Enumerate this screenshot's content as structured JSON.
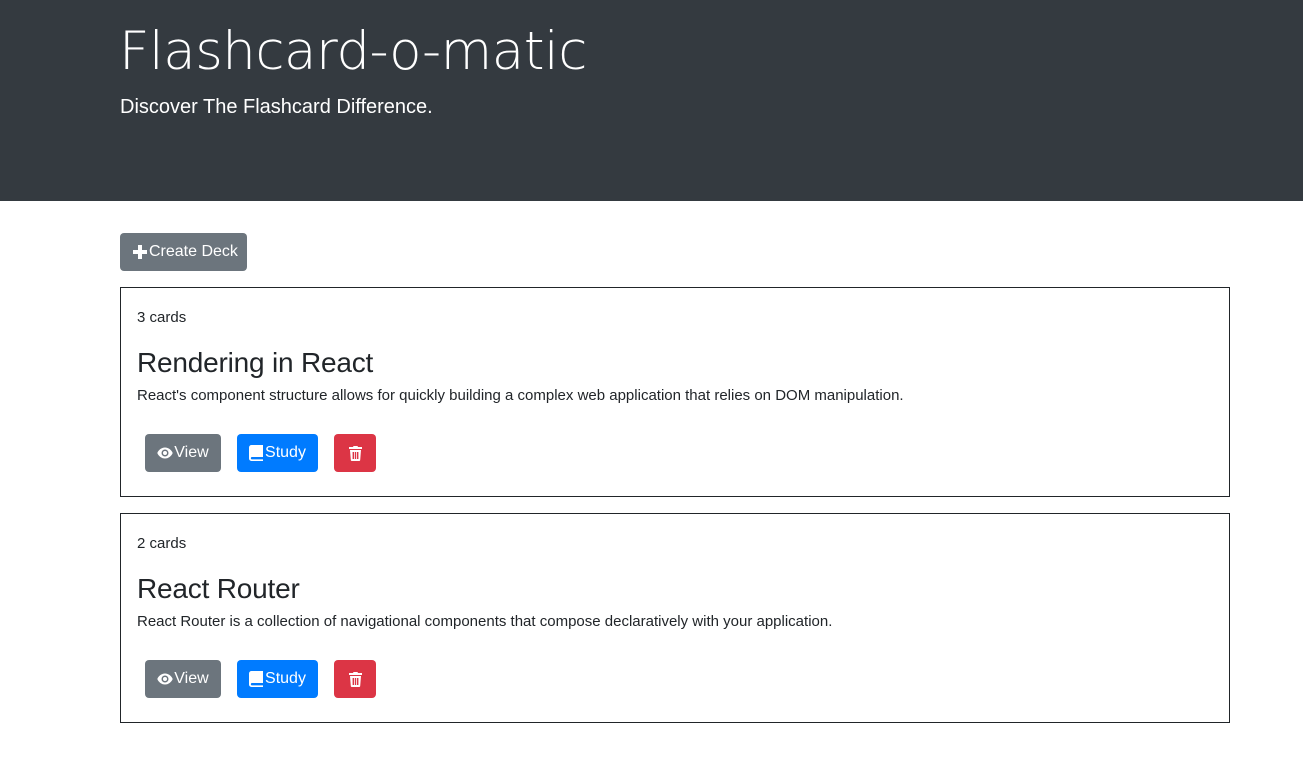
{
  "header": {
    "title": "Flashcard-o-matic",
    "subtitle": "Discover The Flashcard Difference."
  },
  "toolbar": {
    "create_deck_label": "Create Deck"
  },
  "decks": [
    {
      "count": "3 cards",
      "name": "Rendering in React",
      "description": "React's component structure allows for quickly building a complex web application that relies on DOM manipulation.",
      "view_label": "View",
      "study_label": "Study"
    },
    {
      "count": "2 cards",
      "name": "React Router",
      "description": "React Router is a collection of navigational components that compose declaratively with your application.",
      "view_label": "View",
      "study_label": "Study"
    }
  ],
  "icons": {
    "create": "plus-icon",
    "view": "eye-icon",
    "study": "book-icon",
    "delete": "trash-icon"
  },
  "colors": {
    "header_bg": "#343a40",
    "secondary": "#6c757d",
    "primary": "#007bff",
    "danger": "#dc3545"
  }
}
